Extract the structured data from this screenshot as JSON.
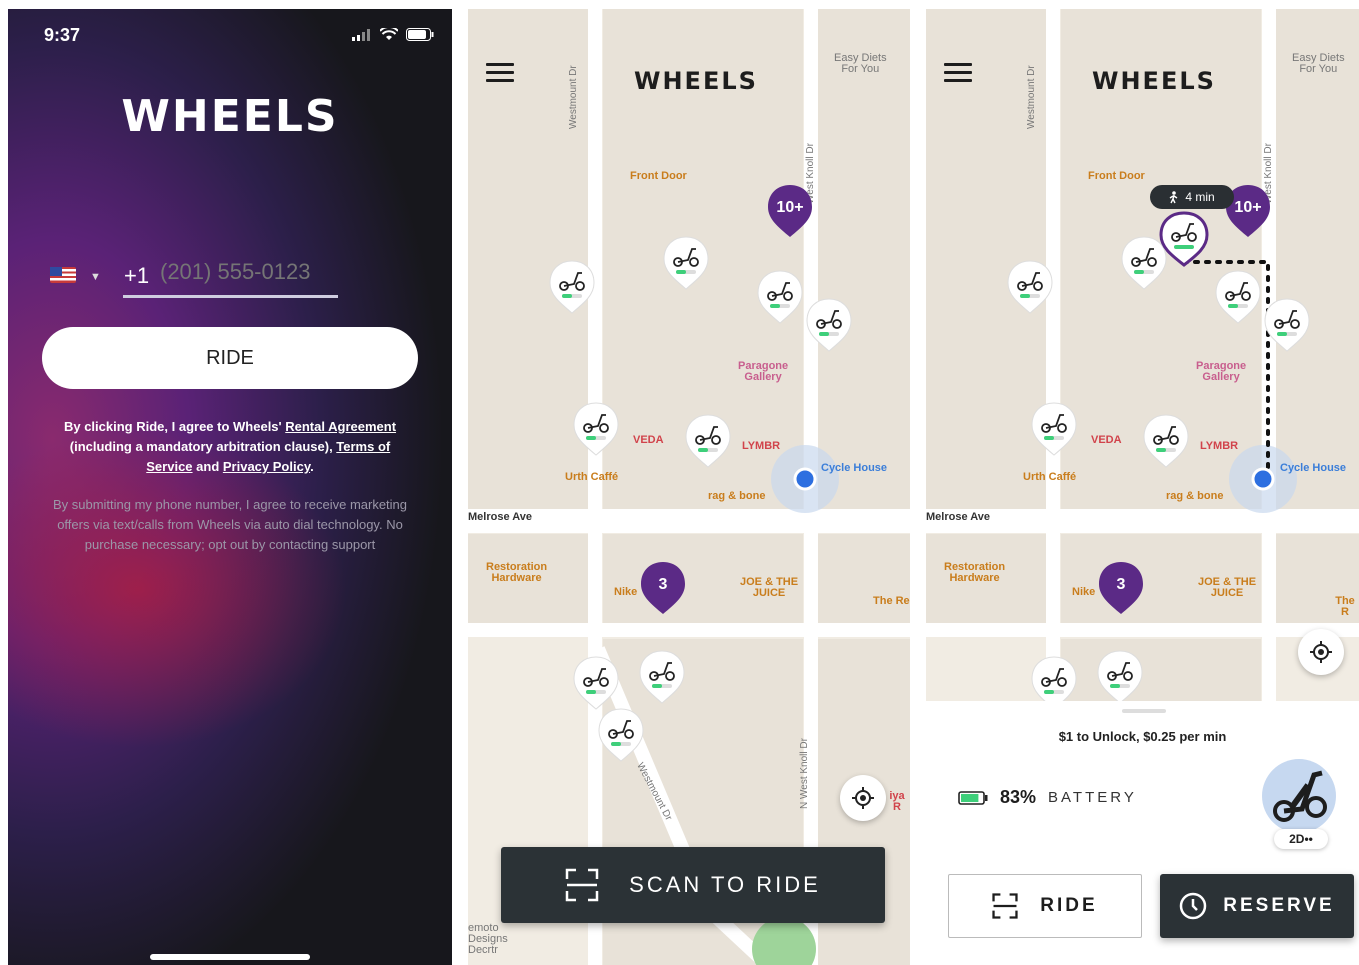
{
  "screen1": {
    "status_time": "9:37",
    "logo": "WHEELS",
    "country_code": "+1",
    "phone_placeholder": "(201) 555-0123",
    "ride_button": "RIDE",
    "legal_prefix": "By clicking Ride, I agree to Wheels' ",
    "legal_link_rental": "Rental Agreement",
    "legal_middle": " (including a mandatory arbitration clause), ",
    "legal_link_terms": "Terms of Service",
    "legal_and": " and ",
    "legal_link_privacy": "Privacy Policy",
    "legal_end": ".",
    "marketing": "By submitting my phone number, I agree to receive marketing offers via text/calls from Wheels via auto dial technology. No purchase necessary; opt out by contacting support"
  },
  "map": {
    "logo": "WHEELS",
    "pois": {
      "easy_diets": "Easy Diets\nFor You",
      "front_door": "Front Door",
      "paragone": "Paragone\nGallery",
      "veda": "VEDA",
      "lymbr": "LYMBR",
      "cycle_house": "Cycle House",
      "urth": "Urth Caffé",
      "rag_bone": "rag & bone",
      "restoration": "Restoration\nHardware",
      "nike": "Nike",
      "joe_juice": "JOE & THE\nJUICE",
      "the_re": "The Re",
      "the_r": "The R",
      "iya_r": "iya R",
      "remoto": "emoto\nDesigns\nDecrtr"
    },
    "streets": {
      "westmount": "Westmount Dr",
      "west_knoll": "West Knoll Dr",
      "n_west_knoll": "N West Knoll Dr",
      "melrose": "Melrose Ave",
      "westmount_diag": "Westmount Dr"
    },
    "clusters": {
      "big": "10+",
      "small": "3"
    }
  },
  "screen2": {
    "scan_button": "SCAN TO RIDE"
  },
  "screen3": {
    "walk_time": "4 min",
    "price": "$1 to Unlock, $0.25 per min",
    "battery_pct": "83%",
    "battery_level": 0.83,
    "battery_label": "BATTERY",
    "model_badge": "2D••",
    "ride_button": "RIDE",
    "reserve_button": "RESERVE"
  },
  "colors": {
    "accent_purple": "#5b2a86",
    "battery_green": "#3ecf7a",
    "dark_button": "#2b3236",
    "user_dot": "#2d6fe0"
  }
}
